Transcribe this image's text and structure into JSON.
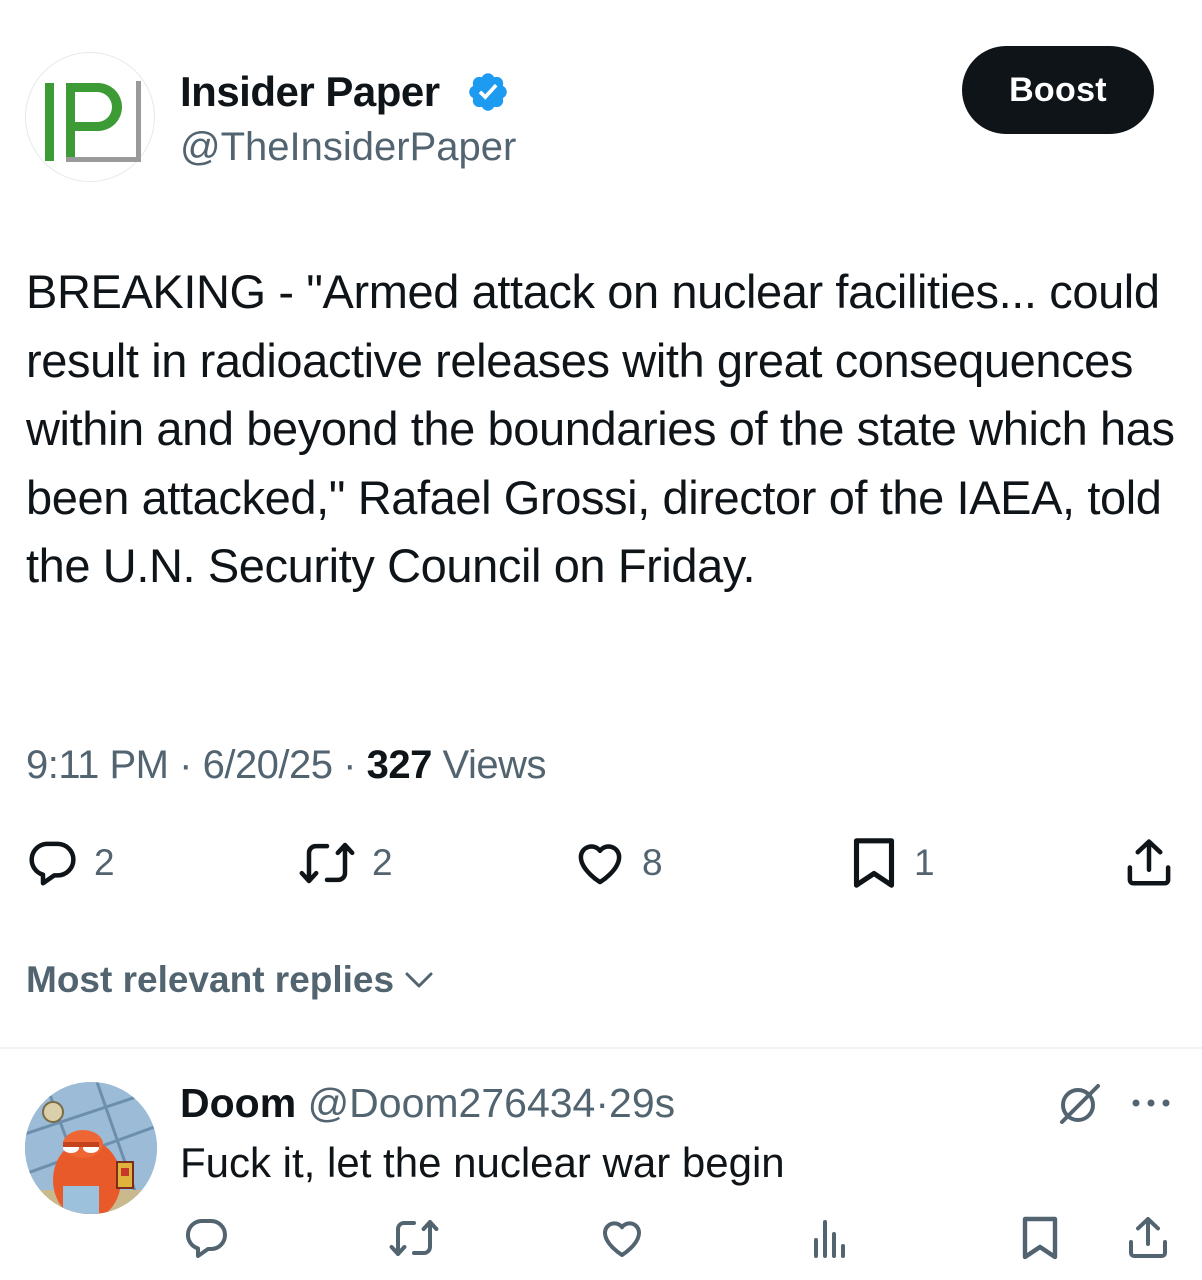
{
  "author": {
    "name": "Insider Paper",
    "handle": "@TheInsiderPaper",
    "avatar_text": "IP",
    "verified": true
  },
  "header": {
    "boost_label": "Boost"
  },
  "tweet": {
    "text": "BREAKING - \"Armed attack on nuclear facilities... could result in radioactive releases with great consequences within and beyond the boundaries of the state which has been attacked,\" Rafael Grossi, director of the IAEA, told the U.N. Security Council on Friday.",
    "time": "9:11 PM",
    "date": "6/20/25",
    "separator": "·",
    "views_count": "327",
    "views_label": "Views"
  },
  "actions": {
    "replies": "2",
    "reposts": "2",
    "likes": "8",
    "bookmarks": "1"
  },
  "replies_sort": {
    "label": "Most relevant replies"
  },
  "reply": {
    "name": "Doom",
    "handle": "@Doom276434",
    "separator": "·",
    "time": "29s",
    "text": "Fuck it, let the nuclear war begin"
  },
  "colors": {
    "text": "#0f1419",
    "secondary": "#536471",
    "verified_blue": "#1d9bf0",
    "logo_green": "#3d9b35",
    "divider": "#eff3f4"
  }
}
